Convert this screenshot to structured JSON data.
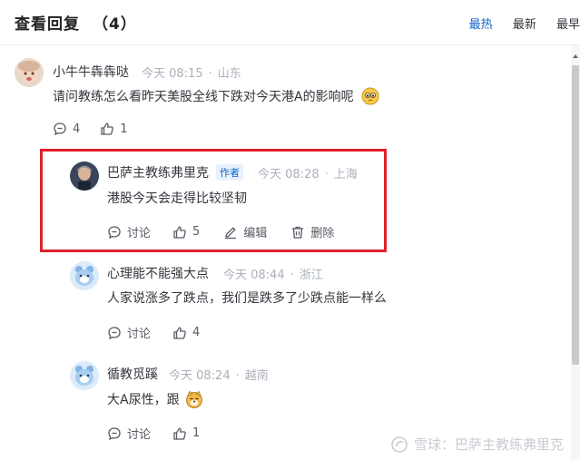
{
  "header": {
    "title": "查看回复",
    "count": "（4）",
    "tabs": [
      "最热",
      "最新",
      "最早"
    ]
  },
  "comments": [
    {
      "author": "小牛牛犇犇哒",
      "time": "今天 08:15",
      "location": "山东",
      "content": "请问教练怎么看昨天美股全线下跌对今天港A的影响呢",
      "replies": "4",
      "likes": "1"
    },
    {
      "author": "巴萨主教练弗里克",
      "badge": "作者",
      "time": "今天 08:28",
      "location": "上海",
      "content": "港股今天会走得比较坚韧",
      "discuss_label": "讨论",
      "likes": "5",
      "edit_label": "编辑",
      "delete_label": "删除"
    },
    {
      "author": "心理能不能强大点",
      "time": "今天 08:44",
      "location": "浙江",
      "content": "人家说涨多了跌点，我们是跌多了少跌点能一样么",
      "discuss_label": "讨论",
      "likes": "4"
    },
    {
      "author": "循教觅蹊",
      "time": "今天 08:24",
      "location": "越南",
      "content": "大A尿性，跟",
      "discuss_label": "讨论",
      "likes": "1"
    }
  ],
  "watermark": "雪球：巴萨主教练弗里克",
  "colors": {
    "accent": "#0f64c8",
    "highlight_border": "#e0202a",
    "muted": "#aab0ba"
  }
}
